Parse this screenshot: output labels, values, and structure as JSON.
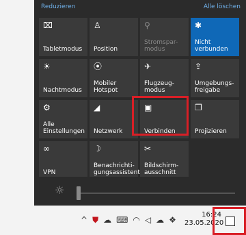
{
  "header": {
    "collapse": "Reduzieren",
    "clear_all": "Alle löschen"
  },
  "tiles": [
    {
      "name": "tile-tabletmodus",
      "icon_name": "tablet-mode-icon",
      "icon": "⌧",
      "label": "Tabletmodus",
      "state": "normal"
    },
    {
      "name": "tile-position",
      "icon_name": "location-icon",
      "icon": "♙",
      "label": "Position",
      "state": "normal"
    },
    {
      "name": "tile-stromsparmodus",
      "icon_name": "battery-saver-icon",
      "icon": "⚲",
      "label": "Stromspar-\nmodus",
      "state": "dim"
    },
    {
      "name": "tile-bluetooth",
      "icon_name": "bluetooth-icon",
      "icon": "✱",
      "label": "Nicht\nverbunden",
      "state": "active"
    },
    {
      "name": "tile-nachtmodus",
      "icon_name": "night-light-icon",
      "icon": "☀",
      "label": "Nachtmodus",
      "state": "normal"
    },
    {
      "name": "tile-mobiler-hotspot",
      "icon_name": "hotspot-icon",
      "icon": "⦿",
      "label": "Mobiler\nHotspot",
      "state": "normal"
    },
    {
      "name": "tile-flugzeugmodus",
      "icon_name": "airplane-icon",
      "icon": "✈",
      "label": "Flugzeug-\nmodus",
      "state": "normal"
    },
    {
      "name": "tile-umgebungsfreigabe",
      "icon_name": "nearby-sharing-icon",
      "icon": "⇪",
      "label": "Umgebungs-\nfreigabe",
      "state": "normal"
    },
    {
      "name": "tile-alle-einstellungen",
      "icon_name": "settings-gear-icon",
      "icon": "⚙",
      "label": "Alle\nEinstellungen",
      "state": "normal"
    },
    {
      "name": "tile-netzwerk",
      "icon_name": "network-icon",
      "icon": "◢",
      "label": "Netzwerk",
      "state": "normal"
    },
    {
      "name": "tile-verbinden",
      "icon_name": "connect-icon",
      "icon": "▣",
      "label": "Verbinden",
      "state": "normal"
    },
    {
      "name": "tile-projizieren",
      "icon_name": "project-icon",
      "icon": "❐",
      "label": "Projizieren",
      "state": "normal"
    },
    {
      "name": "tile-vpn",
      "icon_name": "vpn-icon",
      "icon": "∞",
      "label": "VPN",
      "state": "normal"
    },
    {
      "name": "tile-benachrichtigungsassistent",
      "icon_name": "focus-assist-icon",
      "icon": "☽",
      "label": "Benachrichti-\ngungsassistent",
      "state": "normal"
    },
    {
      "name": "tile-bildschirmausschnitt",
      "icon_name": "screen-snip-icon",
      "icon": "✂",
      "label": "Bildschirm-\nausschnitt",
      "state": "normal"
    }
  ],
  "brightness": {
    "icon_name": "brightness-icon",
    "level": 0.0
  },
  "taskbar": {
    "time": "16:24",
    "date": "23.05.2020",
    "tray_icons": [
      "chevron-up-icon",
      "security-icon",
      "cloud-icon",
      "keyboard-icon",
      "wifi-icon",
      "volume-icon",
      "onedrive-icon",
      "dropbox-icon"
    ]
  }
}
